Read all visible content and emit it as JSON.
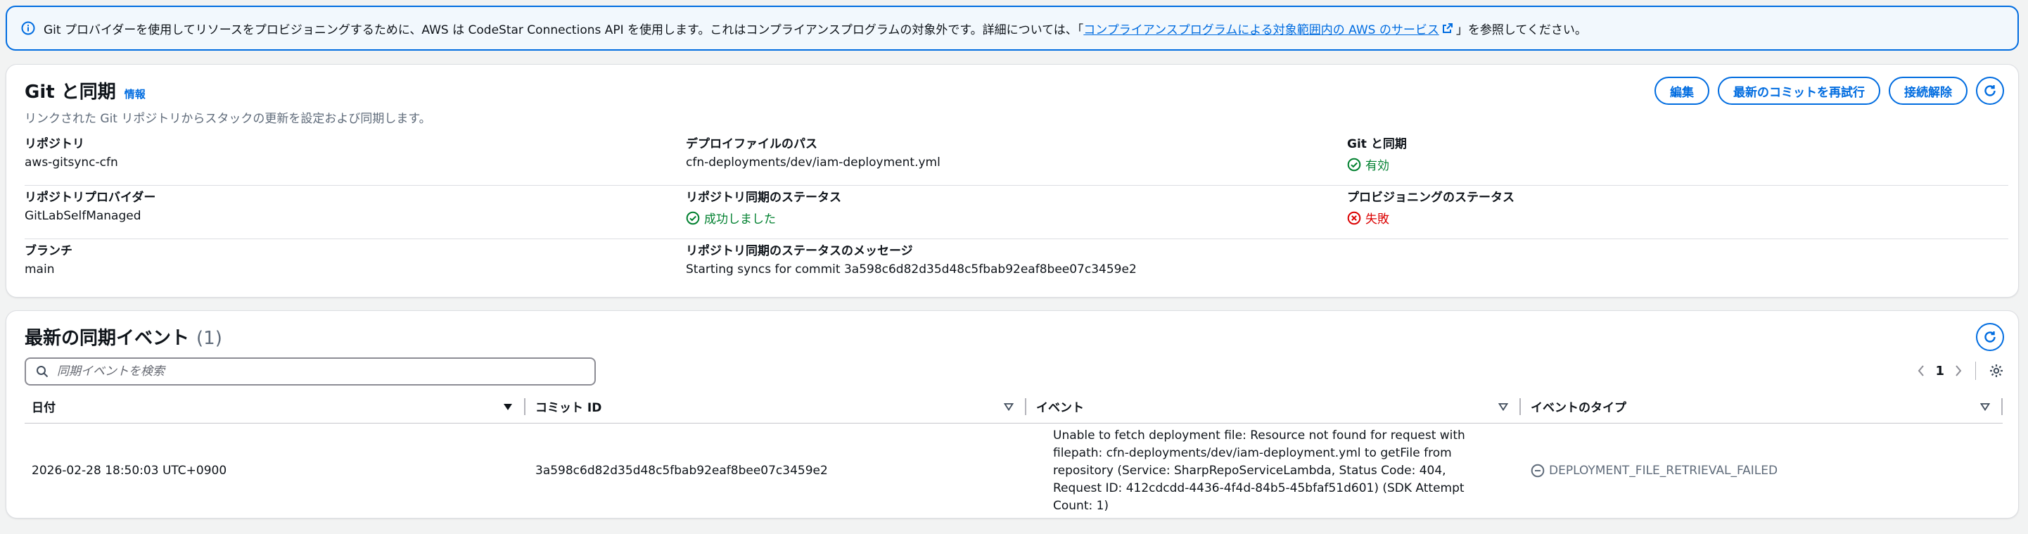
{
  "banner": {
    "text_before": "Git プロバイダーを使用してリソースをプロビジョニングするために、AWS は CodeStar Connections API を使用します。これはコンプライアンスプログラムの対象外です。詳細については、「",
    "link": "コンプライアンスプログラムによる対象範囲内の AWS のサービス",
    "text_after": "」を参照してください。"
  },
  "git_sync": {
    "title": "Git と同期",
    "info": "情報",
    "description": "リンクされた Git リポジトリからスタックの更新を設定および同期します。",
    "buttons": {
      "edit": "編集",
      "retry": "最新のコミットを再試行",
      "disconnect": "接続解除"
    },
    "fields": {
      "repository_label": "リポジトリ",
      "repository_value": "aws-gitsync-cfn",
      "deploy_path_label": "デプロイファイルのパス",
      "deploy_path_value": "cfn-deployments/dev/iam-deployment.yml",
      "git_sync_label": "Git と同期",
      "git_sync_value": "有効",
      "provider_label": "リポジトリプロバイダー",
      "provider_value": "GitLabSelfManaged",
      "sync_status_label": "リポジトリ同期のステータス",
      "sync_status_value": "成功しました",
      "provisioning_label": "プロビジョニングのステータス",
      "provisioning_value": "失敗",
      "branch_label": "ブランチ",
      "branch_value": "main",
      "sync_message_label": "リポジトリ同期のステータスのメッセージ",
      "sync_message_value": "Starting syncs for commit 3a598c6d82d35d48c5fbab92eaf8bee07c3459e2"
    }
  },
  "events": {
    "title": "最新の同期イベント",
    "count": "(1)",
    "search_placeholder": "同期イベントを検索",
    "page": "1",
    "columns": [
      "日付",
      "コミット ID",
      "イベント",
      "イベントのタイプ"
    ],
    "rows": [
      {
        "date": "2026-02-28 18:50:03 UTC+0900",
        "commit": "3a598c6d82d35d48c5fbab92eaf8bee07c3459e2",
        "event": "Unable to fetch deployment file: Resource not found for request with filepath: cfn-deployments/dev/iam-deployment.yml to getFile from repository (Service: SharpRepoServiceLambda, Status Code: 404, Request ID: 412cdcdd-4436-4f4d-84b5-45bfaf51d601) (SDK Attempt Count: 1)",
        "type": "DEPLOYMENT_FILE_RETRIEVAL_FAILED"
      }
    ]
  },
  "colors": {
    "accent": "#006ce0",
    "success": "#00802f",
    "error": "#db0000"
  }
}
